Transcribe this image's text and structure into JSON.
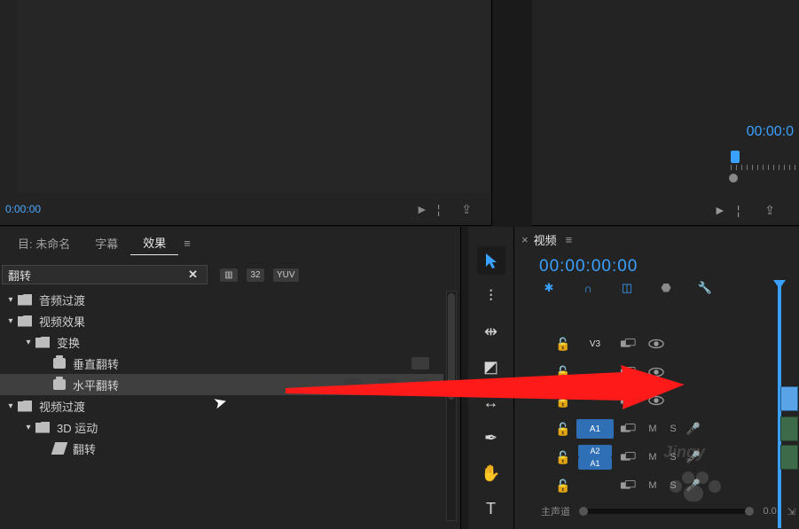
{
  "preview": {
    "timecode_small": "0:00:00",
    "icons": {
      "insert": "►¦",
      "export": "⇪"
    }
  },
  "program": {
    "timecode_partial": "00:00:0",
    "icons": {
      "insert": "►¦",
      "export": "⇪"
    }
  },
  "projectPanel": {
    "tabs": [
      {
        "label": "目: 未命名",
        "active": false
      },
      {
        "label": "字幕",
        "active": false
      },
      {
        "label": "效果",
        "active": true
      }
    ],
    "menuGlyph": "≡",
    "search": {
      "value": "翻转",
      "clear": "✕"
    },
    "filterBadges": [
      "▥",
      "32",
      "YUV"
    ],
    "tree": [
      {
        "indent": 0,
        "kind": "folder",
        "twisty": "▾",
        "label": "音频过渡",
        "sel": false
      },
      {
        "indent": 0,
        "kind": "folder",
        "twisty": "▾",
        "label": "视频效果",
        "sel": false
      },
      {
        "indent": 1,
        "kind": "folder",
        "twisty": "▾",
        "label": "变换",
        "sel": false
      },
      {
        "indent": 2,
        "kind": "preset",
        "twisty": "",
        "label": "垂直翻转",
        "sel": false,
        "chips": 1
      },
      {
        "indent": 2,
        "kind": "preset",
        "twisty": "",
        "label": "水平翻转",
        "sel": true,
        "chips": 3
      },
      {
        "indent": 0,
        "kind": "folder",
        "twisty": "▾",
        "label": "视频过渡",
        "sel": false
      },
      {
        "indent": 1,
        "kind": "folder",
        "twisty": "▾",
        "label": "3D 运动",
        "sel": false
      },
      {
        "indent": 2,
        "kind": "fx",
        "twisty": "",
        "label": "翻转",
        "sel": false
      }
    ]
  },
  "tools": [
    {
      "name": "selection-tool",
      "glyph": "▲",
      "active": true
    },
    {
      "name": "track-select-tool",
      "glyph": "⫶",
      "active": false
    },
    {
      "name": "ripple-edit-tool",
      "glyph": "⇹",
      "active": false
    },
    {
      "name": "razor-tool",
      "glyph": "◩",
      "active": false
    },
    {
      "name": "slip-tool",
      "glyph": "↔",
      "active": false
    },
    {
      "name": "pen-tool",
      "glyph": "✒",
      "active": false
    },
    {
      "name": "hand-tool",
      "glyph": "✋",
      "active": false
    },
    {
      "name": "type-tool",
      "glyph": "T",
      "active": false
    }
  ],
  "timeline": {
    "closeGlyph": "×",
    "tabName": "视频",
    "menuGlyph": "≡",
    "timecode": "00:00:00:00",
    "controls": {
      "nest": "✱",
      "snap": "∩",
      "linked": "◫",
      "markers": "⬣",
      "settings": "🔧"
    },
    "videoTracks": [
      {
        "lock": "🔓",
        "label": "V3",
        "target": false,
        "sync": true,
        "eye": true
      },
      {
        "lock": "🔓",
        "label": "",
        "target": false,
        "sync": true,
        "eye": true
      },
      {
        "lock": "🔓",
        "label": "",
        "target": false,
        "sync": true,
        "eye": true
      }
    ],
    "audioTracks": [
      {
        "lock": "🔓",
        "label": "A1",
        "target": true,
        "sync": true,
        "mute": "M",
        "solo": "S",
        "mic": "🎤"
      },
      {
        "lock": "🔓",
        "label": "A2",
        "sub": "A1",
        "target": true,
        "sync": true,
        "mute": "M",
        "solo": "S",
        "mic": "🎤"
      },
      {
        "lock": "🔓",
        "label": "",
        "target": false,
        "sync": true,
        "mute": "M",
        "solo": "S",
        "mic": "🎤"
      }
    ],
    "masterLabel": "主声道",
    "masterDb": "0.0",
    "btmIcon": "⇲"
  },
  "watermark": "Jingy"
}
